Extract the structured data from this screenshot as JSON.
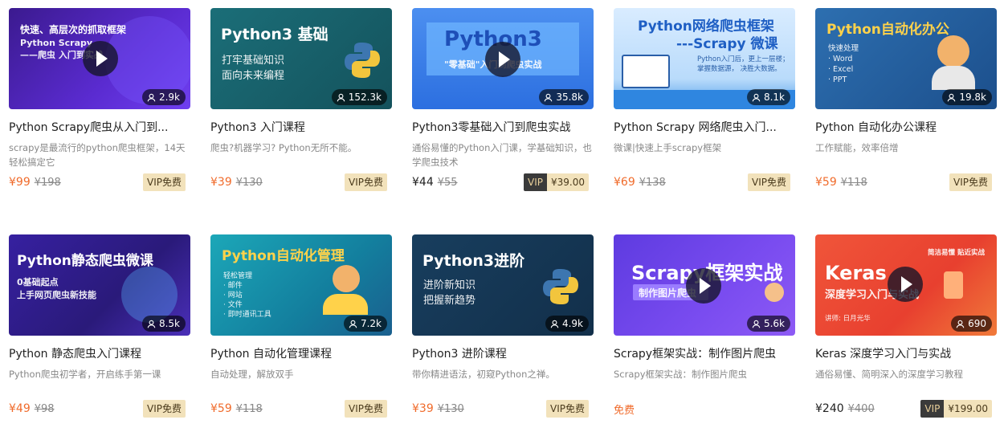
{
  "courses": [
    {
      "thumb_title": "快速、高层次的抓取框架",
      "thumb_sub": "Python Scrapy\n——爬虫 入门到实战",
      "views": "2.9k",
      "title": "Python Scrapy爬虫从入门到...",
      "desc": "scrapy是最流行的python爬虫框架，14天轻松搞定它",
      "price": "¥99",
      "orig": "¥198",
      "vip_label": "VIP免费"
    },
    {
      "thumb_title": "Python3 基础",
      "thumb_sub": "打牢基础知识\n面向未来编程",
      "views": "152.3k",
      "title": "Python3 入门课程",
      "desc": "爬虫?机器学习? Python无所不能。",
      "price": "¥39",
      "orig": "¥130",
      "vip_label": "VIP免费"
    },
    {
      "thumb_title": "Python3",
      "thumb_sub": "\"零基础\"入门到爬虫实战",
      "views": "35.8k",
      "title": "Python3零基础入门到爬虫实战",
      "desc": "通俗易懂的Python入门课，学基础知识，也学爬虫技术",
      "price": "¥44",
      "orig": "¥55",
      "vip_tag": "VIP",
      "vip_amount": "¥39.00"
    },
    {
      "thumb_title": "Python网络爬虫框架",
      "thumb_title2": "---Scrapy 微课",
      "thumb_sub": "Python入门后，更上一层楼；\n掌握数据源，  决胜大数据。",
      "views": "8.1k",
      "title": "Python Scrapy 网络爬虫入门...",
      "desc": "微课|快速上手scrapy框架",
      "price": "¥69",
      "orig": "¥138",
      "vip_label": "VIP免费"
    },
    {
      "thumb_title": "Python自动化办公",
      "thumb_sub": "快速处理\n· Word\n· Excel\n· PPT",
      "views": "19.8k",
      "title": "Python 自动化办公课程",
      "desc": "工作赋能，效率倍增",
      "price": "¥59",
      "orig": "¥118",
      "vip_label": "VIP免费"
    },
    {
      "thumb_title": "Python静态爬虫微课",
      "thumb_sub": "0基础起点\n上手网页爬虫新技能",
      "views": "8.5k",
      "title": "Python 静态爬虫入门课程",
      "desc": "Python爬虫初学者，开启练手第一课",
      "price": "¥49",
      "orig": "¥98",
      "vip_label": "VIP免费"
    },
    {
      "thumb_title": "Python自动化管理",
      "thumb_sub": "轻松管理\n· 邮件\n· 网站\n· 文件\n· 即时通讯工具",
      "views": "7.2k",
      "title": "Python 自动化管理课程",
      "desc": "自动处理，解放双手",
      "price": "¥59",
      "orig": "¥118",
      "vip_label": "VIP免费"
    },
    {
      "thumb_title": "Python3进阶",
      "thumb_sub": "进阶新知识\n把握新趋势",
      "views": "4.9k",
      "title": "Python3 进阶课程",
      "desc": "带你精进语法，初窥Python之禅。",
      "price": "¥39",
      "orig": "¥130",
      "vip_label": "VIP免费"
    },
    {
      "thumb_title": "Scrapy框架实战",
      "thumb_sub": "制作图片爬虫",
      "views": "5.6k",
      "title": "Scrapy框架实战：制作图片爬虫",
      "desc": "Scrapy框架实战：制作图片爬虫",
      "free_label": "免费"
    },
    {
      "thumb_title": "Keras",
      "thumb_sub": "深度学习入门与实战",
      "thumb_corner": "简洁易懂 贴近实战",
      "thumb_author": "讲师: 日月光华",
      "views": "690",
      "title": "Keras 深度学习入门与实战",
      "desc": "通俗易懂、简明深入的深度学习教程",
      "price": "¥240",
      "orig": "¥400",
      "vip_tag": "VIP",
      "vip_amount": "¥199.00"
    }
  ],
  "colors": {
    "price_orange": "#f06b2b",
    "vip_gold_bg": "#f2e2bb",
    "vip_dark_bg": "#3a3a3a"
  }
}
